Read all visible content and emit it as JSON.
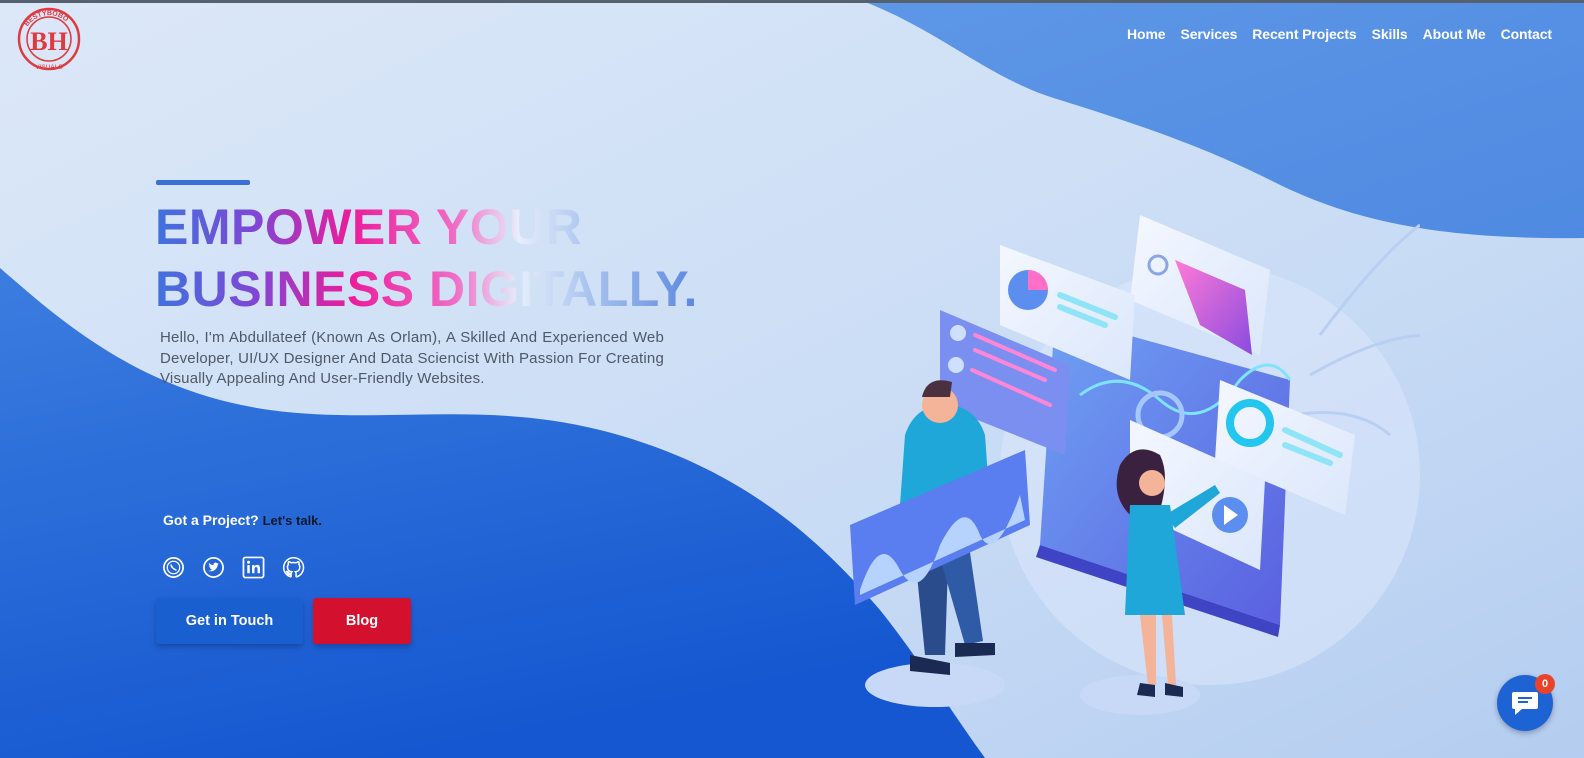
{
  "brand": {
    "logo_top_text": "BESTYBOBO",
    "logo_letters": "BH",
    "logo_bottom_text": "VISUALS",
    "logo_color": "#e03a3f"
  },
  "nav": {
    "items": [
      {
        "label": "Home"
      },
      {
        "label": "Services"
      },
      {
        "label": "Recent Projects"
      },
      {
        "label": "Skills"
      },
      {
        "label": "About Me"
      },
      {
        "label": "Contact"
      }
    ]
  },
  "hero": {
    "headline_line1": "EMPOWER YOUR",
    "headline_line2": "BUSINESS DIGITALLY.",
    "intro": "Hello, I'm Abdullateef (Known As Orlam), A Skilled And Experienced Web Developer, UI/UX Designer And Data Sciencist With Passion For Creating Visually Appealing And User-Friendly Websites.",
    "cta_question": "Got a Project?",
    "cta_talk": "Let's talk."
  },
  "socials": [
    {
      "icon": "whatsapp-icon"
    },
    {
      "icon": "twitter-icon"
    },
    {
      "icon": "linkedin-icon"
    },
    {
      "icon": "github-icon"
    }
  ],
  "buttons": {
    "get_in_touch": "Get in Touch",
    "blog": "Blog"
  },
  "chat": {
    "badge_count": "0"
  },
  "colors": {
    "primary_blue": "#1a5fd0",
    "blog_red": "#d3102e",
    "headline_pink": "#ea1d9b"
  }
}
